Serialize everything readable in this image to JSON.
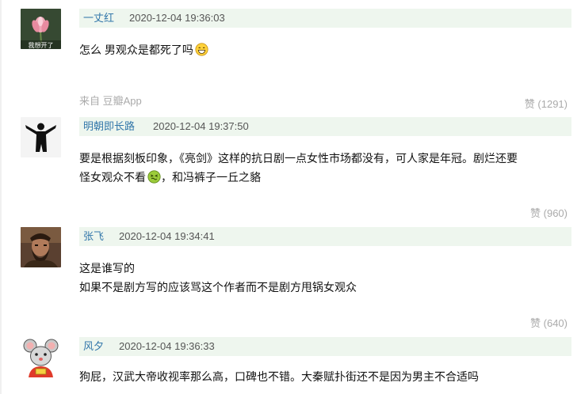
{
  "comments": [
    {
      "user": "一丈红",
      "time": "2020-12-04 19:36:03",
      "avatar_caption": "我想开了",
      "lines": [
        "怎么 男观众是都死了吗"
      ],
      "source": "来自 豆瓣App",
      "likes": "赞 (1291)"
    },
    {
      "user": "明朝即长路",
      "time": "2020-12-04 19:37:50",
      "lines": [
        "要是根据刻板印象，《亮剑》这样的抗日剧一点女性市场都没有，可人家是年冠。剧烂还要",
        "怪女观众不看",
        "，和冯裤子一丘之貉"
      ],
      "likes": "赞 (960)"
    },
    {
      "user": "张飞",
      "time": "2020-12-04 19:34:41",
      "lines": [
        "这是谁写的",
        "如果不是剧方写的应该骂这个作者而不是剧方甩锅女观众"
      ],
      "likes": "赞 (640)"
    },
    {
      "user": "风夕",
      "time": "2020-12-04 19:36:33",
      "lines": [
        "狗屁，汉武大帝收视率那么高，口碑也不错。大秦赋扑街还不是因为男主不合适吗"
      ]
    }
  ],
  "colors": {
    "username": "#3377aa",
    "header_bg": "#eef6ee",
    "muted": "#aaaaaa"
  },
  "icons": [
    "lotus-avatar-icon",
    "grin-emoji-icon",
    "silhouette-avatar-icon",
    "nauseated-emoji-icon",
    "warrior-avatar-icon",
    "mouse-avatar-icon"
  ]
}
